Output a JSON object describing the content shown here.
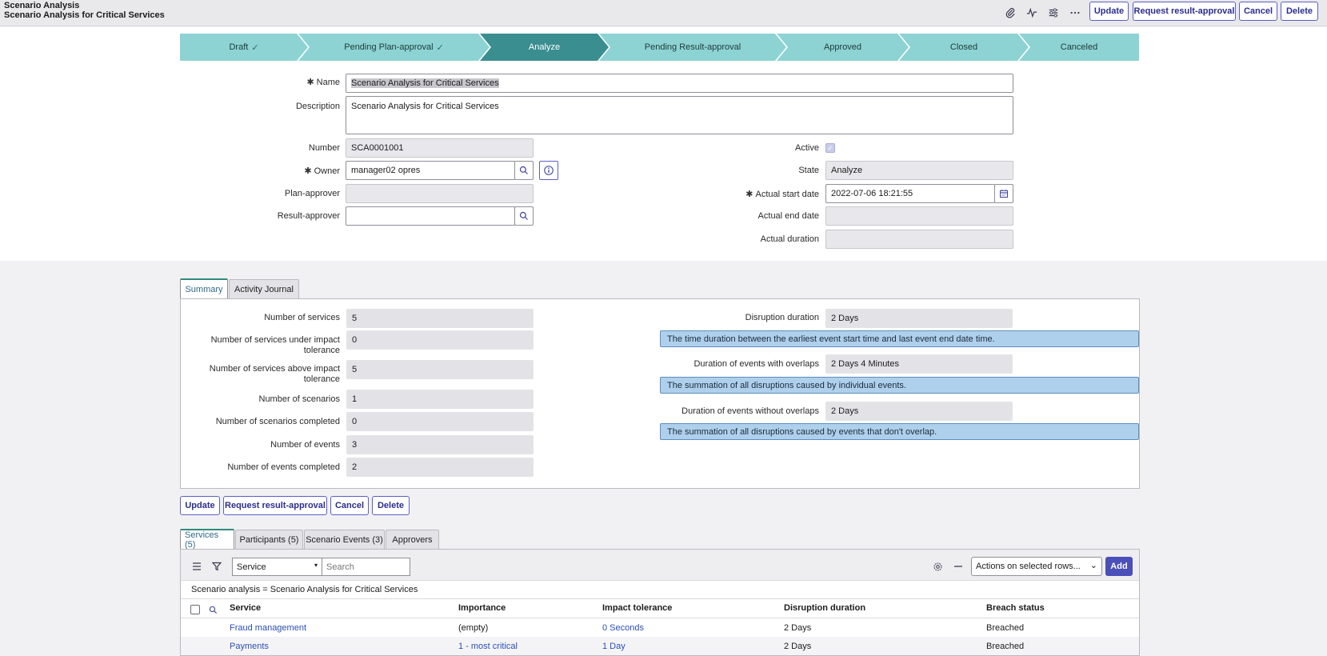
{
  "header": {
    "title": "Scenario Analysis",
    "subtitle": "Scenario Analysis for Critical Services",
    "buttons": {
      "update": "Update",
      "request": "Request result-approval",
      "cancel": "Cancel",
      "delete": "Delete"
    },
    "icons": [
      "paperclip-icon",
      "activity-icon",
      "sliders-icon",
      "more-icon"
    ]
  },
  "stages": [
    {
      "label": "Draft",
      "done": true
    },
    {
      "label": "Pending Plan-approval",
      "done": true
    },
    {
      "label": "Analyze",
      "active": true
    },
    {
      "label": "Pending Result-approval"
    },
    {
      "label": "Approved"
    },
    {
      "label": "Closed"
    },
    {
      "label": "Canceled"
    }
  ],
  "form": {
    "name_label": "Name",
    "name_value": "Scenario Analysis for Critical Services",
    "description_label": "Description",
    "description_value": "Scenario Analysis for Critical Services",
    "number_label": "Number",
    "number_value": "SCA0001001",
    "owner_label": "Owner",
    "owner_value": "manager02 opres",
    "plan_approver_label": "Plan-approver",
    "plan_approver_value": "",
    "result_approver_label": "Result-approver",
    "result_approver_value": "",
    "active_label": "Active",
    "state_label": "State",
    "state_value": "Analyze",
    "start_label": "Actual start date",
    "start_value": "2022-07-06 18:21:55",
    "end_label": "Actual end date",
    "end_value": "",
    "duration_label": "Actual duration",
    "duration_value": ""
  },
  "summary": {
    "tabs": [
      "Summary",
      "Activity Journal"
    ],
    "left": [
      {
        "label": "Number of services",
        "value": "5"
      },
      {
        "label": "Number of services under impact tolerance",
        "value": "0"
      },
      {
        "label": "Number of services above impact tolerance",
        "value": "5"
      },
      {
        "label": "Number of scenarios",
        "value": "1"
      },
      {
        "label": "Number of scenarios completed",
        "value": "0"
      },
      {
        "label": "Number of events",
        "value": "3"
      },
      {
        "label": "Number of events completed",
        "value": "2"
      }
    ],
    "right": [
      {
        "label": "Disruption duration",
        "value": "2 Days",
        "info": "The time duration between the earliest event start time and last event end date time."
      },
      {
        "label": "Duration of events with overlaps",
        "value": "2 Days 4 Minutes",
        "info": "The summation of all disruptions caused by individual events."
      },
      {
        "label": "Duration of events without overlaps",
        "value": "2 Days",
        "info": "The summation of all disruptions caused by events that don't overlap."
      }
    ]
  },
  "bottom_buttons": {
    "update": "Update",
    "request": "Request result-approval",
    "cancel": "Cancel",
    "delete": "Delete"
  },
  "related": {
    "tabs": [
      "Services (5)",
      "Participants (5)",
      "Scenario Events (3)",
      "Approvers"
    ],
    "search_field": "Service",
    "search_placeholder": "Search",
    "actions": "Actions on selected rows...",
    "add": "Add",
    "breadcrumb": "Scenario analysis = Scenario Analysis for Critical Services",
    "columns": [
      "Service",
      "Importance",
      "Impact tolerance",
      "Disruption duration",
      "Breach status"
    ],
    "rows": [
      {
        "service": "Fraud management",
        "importance": "(empty)",
        "tolerance": "0 Seconds",
        "duration": "2 Days",
        "breach": "Breached"
      },
      {
        "service": "Payments",
        "importance": "1 - most critical",
        "tolerance": "1 Day",
        "duration": "2 Days",
        "breach": "Breached"
      }
    ]
  }
}
